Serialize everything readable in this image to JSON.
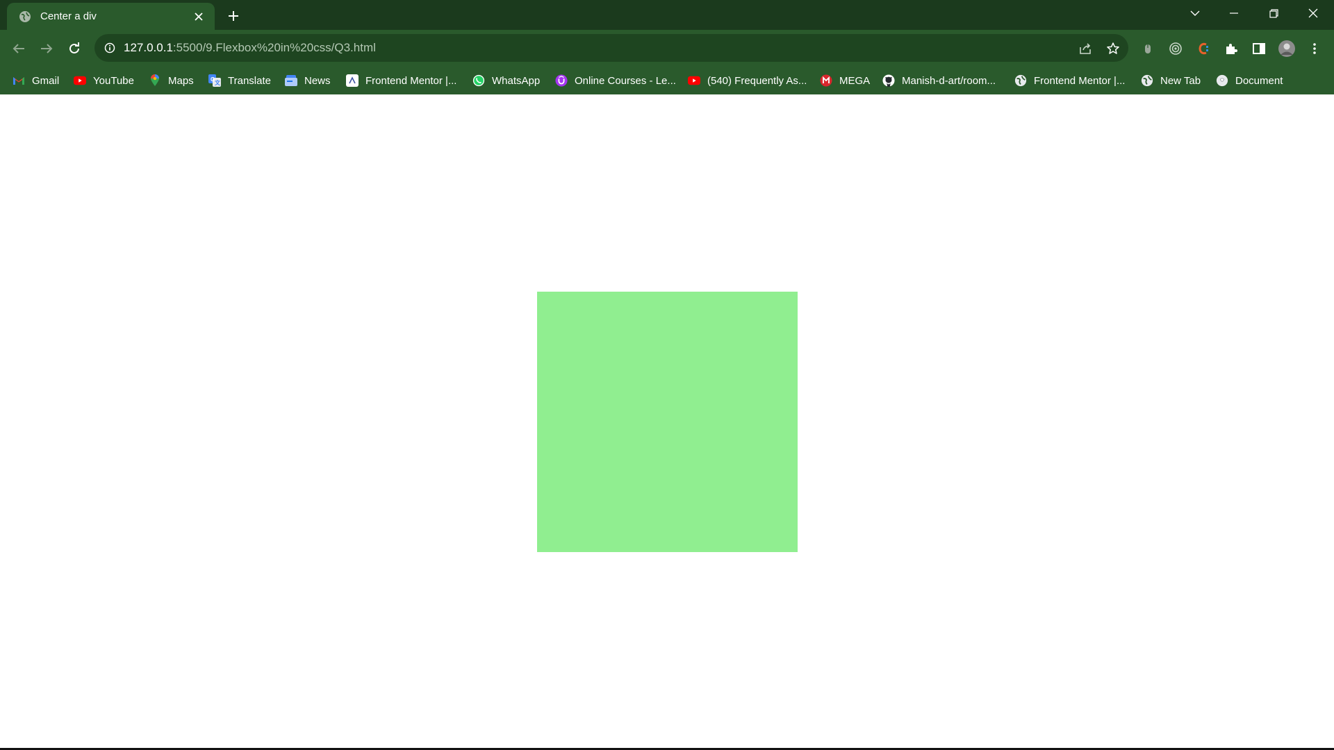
{
  "tab": {
    "title": "Center a div"
  },
  "omnibox": {
    "host": "127.0.0.1",
    "path": ":5500/9.Flexbox%20in%20css/Q3.html"
  },
  "bookmarks": [
    {
      "label": "Gmail",
      "icon": "gmail-icon"
    },
    {
      "label": "YouTube",
      "icon": "youtube-icon"
    },
    {
      "label": "Maps",
      "icon": "maps-icon"
    },
    {
      "label": "Translate",
      "icon": "translate-icon"
    },
    {
      "label": "News",
      "icon": "news-icon"
    },
    {
      "label": "Frontend Mentor |...",
      "icon": "frontend-mentor-icon"
    },
    {
      "label": "WhatsApp",
      "icon": "whatsapp-icon"
    },
    {
      "label": "Online Courses - Le...",
      "icon": "udemy-icon"
    },
    {
      "label": "(540) Frequently As...",
      "icon": "youtube-icon"
    },
    {
      "label": "MEGA",
      "icon": "mega-icon"
    },
    {
      "label": "Manish-d-art/room...",
      "icon": "github-icon"
    },
    {
      "label": "Frontend Mentor |...",
      "icon": "globe-icon"
    },
    {
      "label": "New Tab",
      "icon": "globe-icon"
    },
    {
      "label": "Document",
      "icon": "document-icon"
    }
  ],
  "colors": {
    "tab_strip": "#1b3a1d",
    "toolbar": "#2a5a2c",
    "box": "#90ee90",
    "page_bg": "#ffffff"
  }
}
